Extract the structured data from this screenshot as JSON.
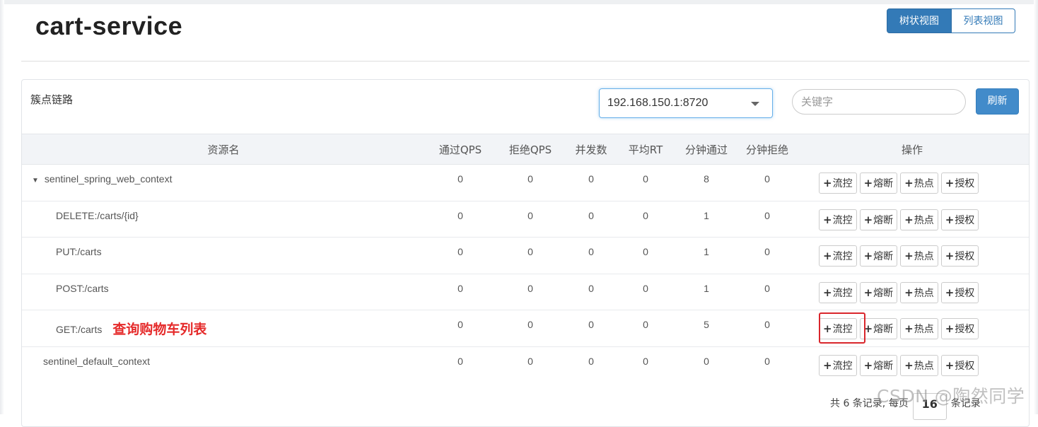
{
  "app": {
    "title": "cart-service"
  },
  "view_toggle": {
    "tree_view": "树状视图",
    "list_view": "列表视图"
  },
  "panel": {
    "title": "簇点链路",
    "machine_select": {
      "value": "192.168.150.1:8720"
    },
    "keyword": {
      "placeholder": "关键字",
      "value": ""
    },
    "refresh_label": "刷新"
  },
  "table": {
    "headers": {
      "resource": "资源名",
      "pass_qps": "通过QPS",
      "block_qps": "拒绝QPS",
      "concurrency": "并发数",
      "avg_rt": "平均RT",
      "minute_pass": "分钟通过",
      "minute_block": "分钟拒绝",
      "ops": "操作"
    },
    "op_labels": {
      "flow": "流控",
      "degrade": "熔断",
      "hotspot": "热点",
      "auth": "授权"
    },
    "rows": [
      {
        "name": "sentinel_spring_web_context",
        "pass_qps": "0",
        "block_qps": "0",
        "concurrency": "0",
        "avg_rt": "0",
        "minute_pass": "8",
        "minute_block": "0"
      },
      {
        "name": "DELETE:/carts/{id}",
        "pass_qps": "0",
        "block_qps": "0",
        "concurrency": "0",
        "avg_rt": "0",
        "minute_pass": "1",
        "minute_block": "0"
      },
      {
        "name": "PUT:/carts",
        "pass_qps": "0",
        "block_qps": "0",
        "concurrency": "0",
        "avg_rt": "0",
        "minute_pass": "1",
        "minute_block": "0"
      },
      {
        "name": "POST:/carts",
        "pass_qps": "0",
        "block_qps": "0",
        "concurrency": "0",
        "avg_rt": "0",
        "minute_pass": "1",
        "minute_block": "0"
      },
      {
        "name": "GET:/carts",
        "annotation": "查询购物车列表",
        "pass_qps": "0",
        "block_qps": "0",
        "concurrency": "0",
        "avg_rt": "0",
        "minute_pass": "5",
        "minute_block": "0"
      },
      {
        "name": "sentinel_default_context",
        "pass_qps": "0",
        "block_qps": "0",
        "concurrency": "0",
        "avg_rt": "0",
        "minute_pass": "0",
        "minute_block": "0"
      }
    ]
  },
  "pager": {
    "prefix": "共 6 条记录, 每页",
    "page_size": "16",
    "suffix": "条记录"
  },
  "watermark": "CSDN @陶然同学",
  "colors": {
    "primary": "#337ab7",
    "annotation_red": "#e52a2a",
    "highlight_border": "#d9262c"
  }
}
